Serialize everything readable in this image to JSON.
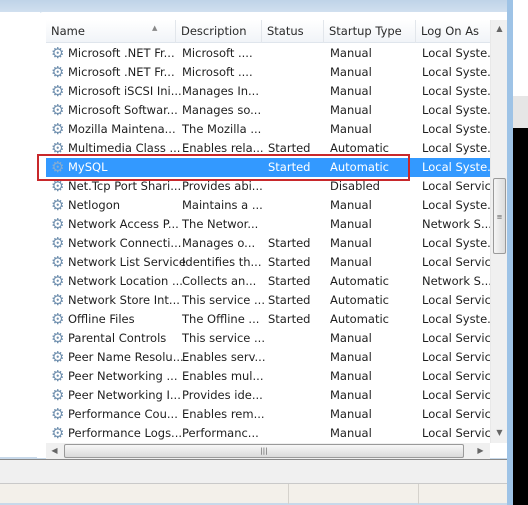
{
  "columns": [
    "Name",
    "Description",
    "Status",
    "Startup Type",
    "Log On As"
  ],
  "rows": [
    [
      "Microsoft .NET Fr...",
      "Microsoft ....",
      "",
      "Manual",
      "Local Syste..."
    ],
    [
      "Microsoft .NET Fr...",
      "Microsoft ....",
      "",
      "Manual",
      "Local Syste..."
    ],
    [
      "Microsoft iSCSI Ini...",
      "Manages In...",
      "",
      "Manual",
      "Local Syste..."
    ],
    [
      "Microsoft Softwar...",
      "Manages so...",
      "",
      "Manual",
      "Local Syste..."
    ],
    [
      "Mozilla Maintena...",
      "The Mozilla ...",
      "",
      "Manual",
      "Local Syste..."
    ],
    [
      "Multimedia Class ...",
      "Enables rela...",
      "Started",
      "Automatic",
      "Local Syste..."
    ],
    [
      "MySQL",
      "",
      "Started",
      "Automatic",
      "Local Syste..."
    ],
    [
      "Net.Tcp Port Shari...",
      "Provides abi...",
      "",
      "Disabled",
      "Local Service"
    ],
    [
      "Netlogon",
      "Maintains a ...",
      "",
      "Manual",
      "Local Syste..."
    ],
    [
      "Network Access P...",
      "The Networ...",
      "",
      "Manual",
      "Network S..."
    ],
    [
      "Network Connecti...",
      "Manages o...",
      "Started",
      "Manual",
      "Local Syste..."
    ],
    [
      "Network List Service",
      "Identifies th...",
      "Started",
      "Manual",
      "Local Service"
    ],
    [
      "Network Location ...",
      "Collects an...",
      "Started",
      "Automatic",
      "Network S..."
    ],
    [
      "Network Store Int...",
      "This service ...",
      "Started",
      "Automatic",
      "Local Service"
    ],
    [
      "Offline Files",
      "The Offline ...",
      "Started",
      "Automatic",
      "Local Syste..."
    ],
    [
      "Parental Controls",
      "This service ...",
      "",
      "Manual",
      "Local Service"
    ],
    [
      "Peer Name Resolu...",
      "Enables serv...",
      "",
      "Manual",
      "Local Service"
    ],
    [
      "Peer Networking ...",
      "Enables mul...",
      "",
      "Manual",
      "Local Service"
    ],
    [
      "Peer Networking I...",
      "Provides ide...",
      "",
      "Manual",
      "Local Service"
    ],
    [
      "Performance Cou...",
      "Enables rem...",
      "",
      "Manual",
      "Local Service"
    ],
    [
      "Performance Logs...",
      "Performanc...",
      "",
      "Manual",
      "Local Service"
    ]
  ],
  "selected_row": 6,
  "icons": {
    "row": "gear-icon",
    "sort": "sort-ascending-icon"
  },
  "colors": {
    "selection": "#3399ff",
    "highlight_box": "#c8282b"
  }
}
